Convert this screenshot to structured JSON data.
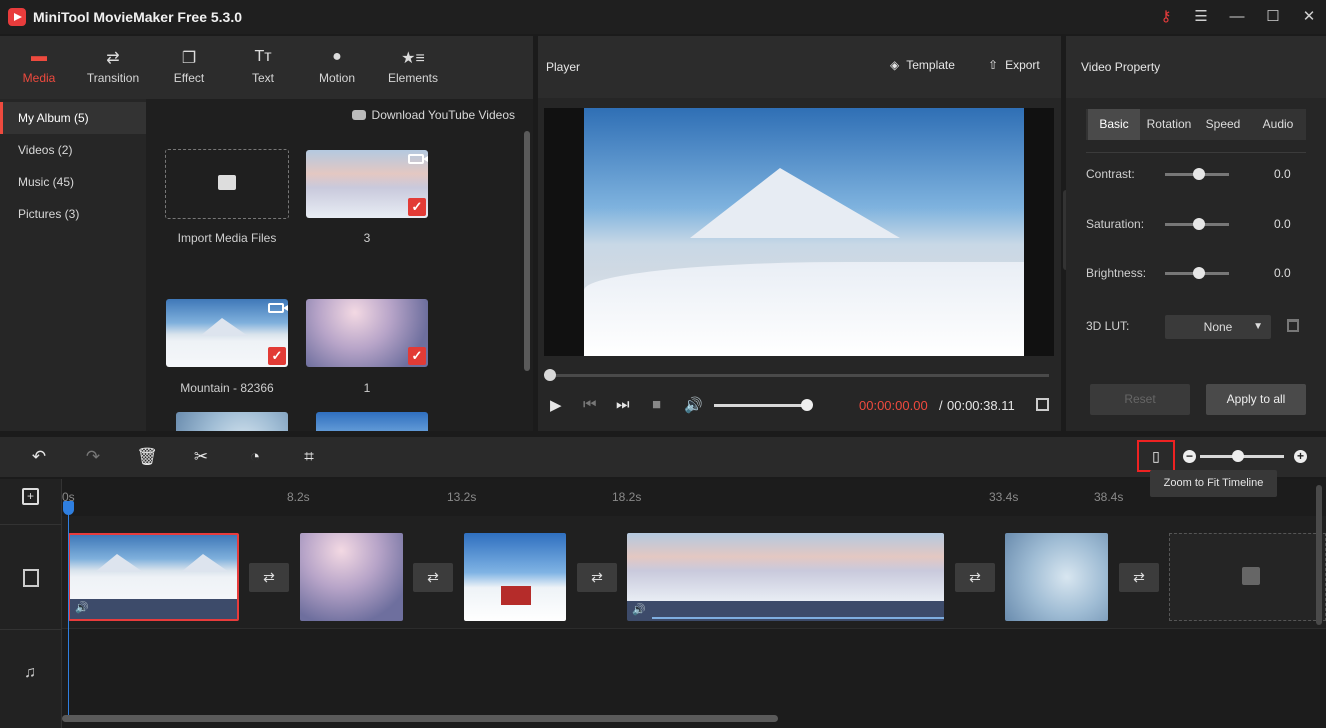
{
  "app": {
    "title": "MiniTool MovieMaker Free 5.3.0"
  },
  "window_controls": {
    "key": "⚷",
    "menu": "☰",
    "minimize": "—",
    "maximize": "☐",
    "close": "✕"
  },
  "media_tabs": [
    {
      "label": "Media",
      "icon": "folder-icon",
      "glyph": "▬",
      "active": true
    },
    {
      "label": "Transition",
      "icon": "transition-icon",
      "glyph": "⇄"
    },
    {
      "label": "Effect",
      "icon": "effect-icon",
      "glyph": "❐"
    },
    {
      "label": "Text",
      "icon": "text-icon",
      "glyph": "Tт"
    },
    {
      "label": "Motion",
      "icon": "motion-icon",
      "glyph": "●"
    },
    {
      "label": "Elements",
      "icon": "elements-icon",
      "glyph": "★≡"
    }
  ],
  "album_list": [
    {
      "label": "My Album (5)",
      "active": true
    },
    {
      "label": "Videos (2)"
    },
    {
      "label": "Music (45)"
    },
    {
      "label": "Pictures (3)"
    }
  ],
  "download_link": "Download YouTube Videos",
  "media_items": [
    {
      "label": "Import Media Files",
      "kind": "import"
    },
    {
      "label": "3",
      "kind": "video"
    },
    {
      "label": "Mountain - 82366",
      "kind": "video"
    },
    {
      "label": "1",
      "kind": "image"
    },
    {
      "label": "",
      "kind": "image"
    },
    {
      "label": "",
      "kind": "image"
    }
  ],
  "player": {
    "title": "Player",
    "template_label": "Template",
    "export_label": "Export",
    "time_current": "00:00:00.00",
    "time_separator": "/",
    "time_total": "00:00:38.11",
    "volume_level": 0.9,
    "seek_position": 0.0
  },
  "property": {
    "title": "Video Property",
    "tabs": [
      "Basic",
      "Rotation",
      "Speed",
      "Audio"
    ],
    "active_tab": "Basic",
    "sliders": [
      {
        "label": "Contrast:",
        "value": "0.0"
      },
      {
        "label": "Saturation:",
        "value": "0.0"
      },
      {
        "label": "Brightness:",
        "value": "0.0"
      }
    ],
    "lut_label": "3D LUT:",
    "lut_value": "None",
    "reset_label": "Reset",
    "apply_label": "Apply to all"
  },
  "timeline": {
    "tooltip": "Zoom to Fit Timeline",
    "ticks": [
      "0s",
      "8.2s",
      "13.2s",
      "18.2s",
      "33.4s",
      "38.4s"
    ],
    "zoom_level": 0.45
  },
  "colors": {
    "accent": "#ee4a3e",
    "playhead": "#2f7fe0",
    "panel": "#262626"
  }
}
